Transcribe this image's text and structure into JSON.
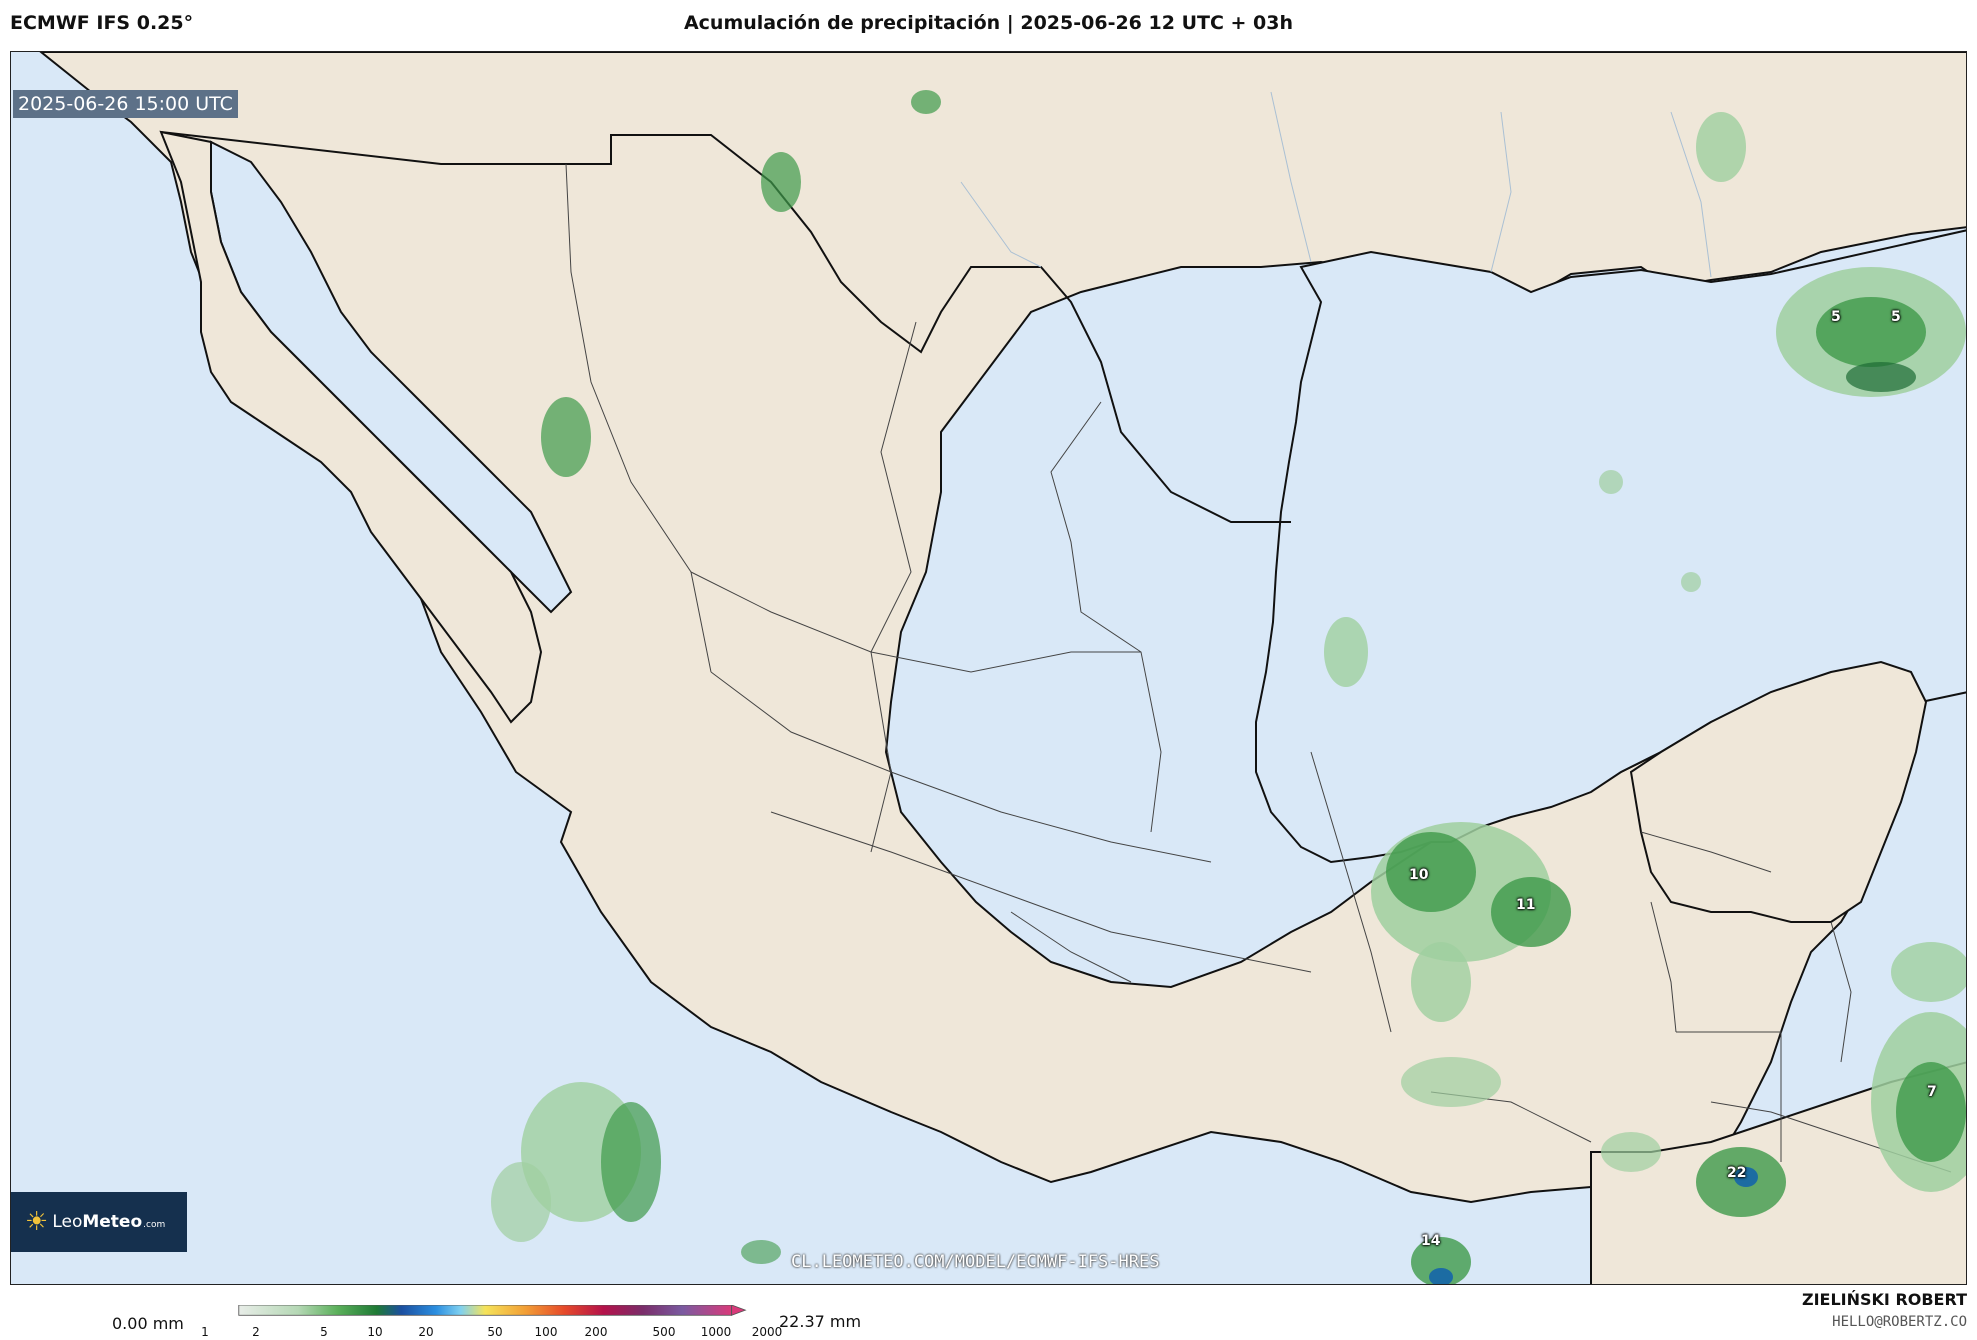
{
  "header": {
    "model": "ECMWF IFS 0.25°",
    "title": "Acumulación de precipitación | 2025-06-26 12 UTC + 03h"
  },
  "map": {
    "valid_time": "2025-06-26 15:00 UTC",
    "watermark": "CL.LEOMETEO.COM/MODEL/ECMWF-IFS-HRES",
    "colors": {
      "ocean": "#d9e8f7",
      "land": "#efe7d9",
      "coast": "#111111",
      "precip_light": "#9fcf9f",
      "precip_mid": "#3f9a4a",
      "precip_heavy": "#1d6b34"
    },
    "precip_labels": [
      {
        "id": "gulf-north-a",
        "value": "5"
      },
      {
        "id": "gulf-north-b",
        "value": "5"
      },
      {
        "id": "campeche-a",
        "value": "10"
      },
      {
        "id": "campeche-b",
        "value": "11"
      },
      {
        "id": "caribbean",
        "value": "7"
      },
      {
        "id": "guatemala",
        "value": "22"
      },
      {
        "id": "pacific-south",
        "value": "14"
      }
    ]
  },
  "logo": {
    "name_light": "Leo",
    "name_bold": "Meteo",
    "domain": ".com"
  },
  "legend": {
    "min_label": "0.00 mm",
    "max_label": "22.37 mm",
    "ticks": [
      "1",
      "2",
      "5",
      "10",
      "20",
      "50",
      "100",
      "200",
      "500",
      "1000",
      "2000"
    ]
  },
  "footer": {
    "author": "ZIELIŃSKI ROBERT",
    "email": "HELLO@ROBERTZ.CO"
  }
}
